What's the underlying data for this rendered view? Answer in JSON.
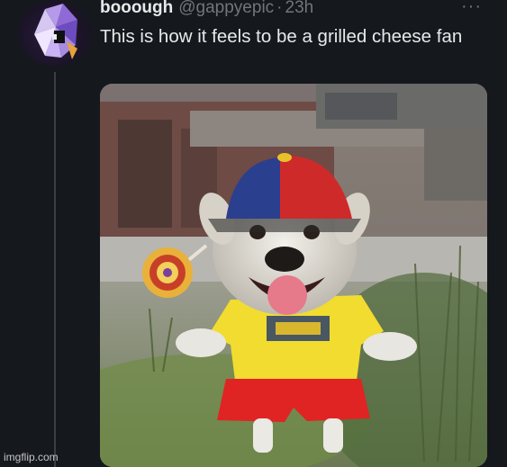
{
  "tweet": {
    "display_name": "booough",
    "handle": "@gappyepic",
    "separator": "·",
    "time": "23h",
    "more_label": "···",
    "text": "This is how it feels to be a grilled cheese fan"
  },
  "media": {
    "image": "dog-in-costume-photo"
  },
  "watermark": "imgflip.com",
  "colors": {
    "background": "#15181c",
    "text_primary": "#e7e9ea",
    "text_secondary": "#71767b"
  }
}
